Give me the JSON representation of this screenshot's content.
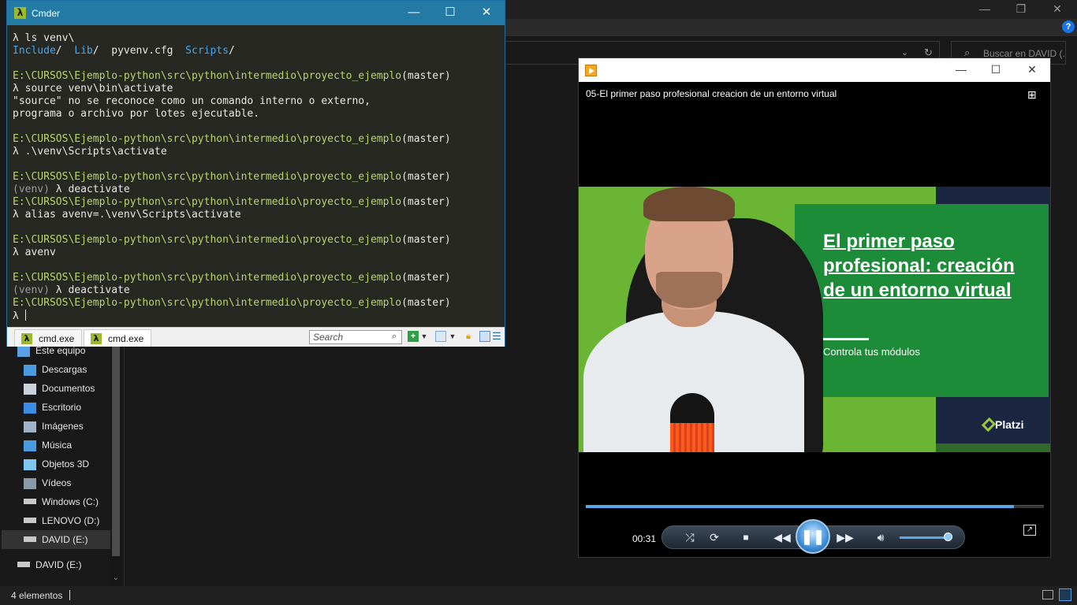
{
  "explorer": {
    "search_placeholder": "Buscar en DAVID (...",
    "help_label": "?",
    "nav": [
      {
        "label": "Este equipo",
        "icon": "computer-icon"
      },
      {
        "label": "Descargas",
        "icon": "download-icon"
      },
      {
        "label": "Documentos",
        "icon": "document-icon"
      },
      {
        "label": "Escritorio",
        "icon": "desktop-icon"
      },
      {
        "label": "Imágenes",
        "icon": "image-icon"
      },
      {
        "label": "Música",
        "icon": "music-icon"
      },
      {
        "label": "Objetos 3D",
        "icon": "cube-icon"
      },
      {
        "label": "Vídeos",
        "icon": "video-icon"
      },
      {
        "label": "Windows (C:)",
        "icon": "drive-icon"
      },
      {
        "label": "LENOVO (D:)",
        "icon": "drive-icon"
      },
      {
        "label": "DAVID (E:)",
        "icon": "drive-icon"
      },
      {
        "label": "DAVID (E:)",
        "icon": "drive-icon"
      }
    ],
    "status": "4 elementos"
  },
  "cmder": {
    "title": "Cmder",
    "logo": "λ",
    "lines": [
      {
        "segments": [
          {
            "t": "λ ls venv\\",
            "c": "prompt"
          }
        ]
      },
      {
        "segments": [
          {
            "t": "Include",
            "c": "dir"
          },
          {
            "t": "/  ",
            "c": "out"
          },
          {
            "t": "Lib",
            "c": "dir"
          },
          {
            "t": "/  pyvenv.cfg  ",
            "c": "out"
          },
          {
            "t": "Scripts",
            "c": "dir"
          },
          {
            "t": "/",
            "c": "out"
          }
        ]
      },
      {
        "segments": [
          {
            "t": " ",
            "c": "out"
          }
        ]
      },
      {
        "segments": [
          {
            "t": "E:\\CURSOS\\Ejemplo-python\\src\\python\\intermedio\\proyecto_ejemplo",
            "c": "path"
          },
          {
            "t": "(master)",
            "c": "branch"
          }
        ]
      },
      {
        "segments": [
          {
            "t": "λ source venv\\bin\\activate",
            "c": "prompt"
          }
        ]
      },
      {
        "segments": [
          {
            "t": "\"source\" no se reconoce como un comando interno o externo,",
            "c": "out"
          }
        ]
      },
      {
        "segments": [
          {
            "t": "programa o archivo por lotes ejecutable.",
            "c": "out"
          }
        ]
      },
      {
        "segments": [
          {
            "t": " ",
            "c": "out"
          }
        ]
      },
      {
        "segments": [
          {
            "t": "E:\\CURSOS\\Ejemplo-python\\src\\python\\intermedio\\proyecto_ejemplo",
            "c": "path"
          },
          {
            "t": "(master)",
            "c": "branch"
          }
        ]
      },
      {
        "segments": [
          {
            "t": "λ .\\venv\\Scripts\\activate",
            "c": "prompt"
          }
        ]
      },
      {
        "segments": [
          {
            "t": " ",
            "c": "out"
          }
        ]
      },
      {
        "segments": [
          {
            "t": "E:\\CURSOS\\Ejemplo-python\\src\\python\\intermedio\\proyecto_ejemplo",
            "c": "path"
          },
          {
            "t": "(master)",
            "c": "branch"
          }
        ]
      },
      {
        "segments": [
          {
            "t": "(venv) ",
            "c": "dim"
          },
          {
            "t": "λ deactivate",
            "c": "prompt"
          }
        ]
      },
      {
        "segments": [
          {
            "t": "E:\\CURSOS\\Ejemplo-python\\src\\python\\intermedio\\proyecto_ejemplo",
            "c": "path"
          },
          {
            "t": "(master)",
            "c": "branch"
          }
        ]
      },
      {
        "segments": [
          {
            "t": "λ alias avenv=.\\venv\\Scripts\\activate",
            "c": "prompt"
          }
        ]
      },
      {
        "segments": [
          {
            "t": " ",
            "c": "out"
          }
        ]
      },
      {
        "segments": [
          {
            "t": "E:\\CURSOS\\Ejemplo-python\\src\\python\\intermedio\\proyecto_ejemplo",
            "c": "path"
          },
          {
            "t": "(master)",
            "c": "branch"
          }
        ]
      },
      {
        "segments": [
          {
            "t": "λ avenv",
            "c": "prompt"
          }
        ]
      },
      {
        "segments": [
          {
            "t": " ",
            "c": "out"
          }
        ]
      },
      {
        "segments": [
          {
            "t": "E:\\CURSOS\\Ejemplo-python\\src\\python\\intermedio\\proyecto_ejemplo",
            "c": "path"
          },
          {
            "t": "(master)",
            "c": "branch"
          }
        ]
      },
      {
        "segments": [
          {
            "t": "(venv) ",
            "c": "dim"
          },
          {
            "t": "λ deactivate",
            "c": "prompt"
          }
        ]
      },
      {
        "segments": [
          {
            "t": "E:\\CURSOS\\Ejemplo-python\\src\\python\\intermedio\\proyecto_ejemplo",
            "c": "path"
          },
          {
            "t": "(master)",
            "c": "branch"
          }
        ]
      },
      {
        "segments": [
          {
            "t": "λ ",
            "c": "prompt"
          }
        ],
        "cursor": true
      }
    ],
    "tabs": [
      "cmd.exe",
      "cmd.exe"
    ],
    "search_placeholder": "Search"
  },
  "player": {
    "title_caption": "05-El primer paso profesional creacion de un entorno virtual",
    "video": {
      "card_title": "El primer paso profesional: creación de un entorno virtual",
      "card_subtitle": "Controla tus módulos",
      "brand": "Platzi"
    },
    "time": "00:31",
    "progress": 0.935,
    "volume": 0.95,
    "colors": {
      "accent": "#58a7e8",
      "card_green": "#1d8c38",
      "bg_green": "#6bb535",
      "navy": "#1b2641"
    }
  }
}
